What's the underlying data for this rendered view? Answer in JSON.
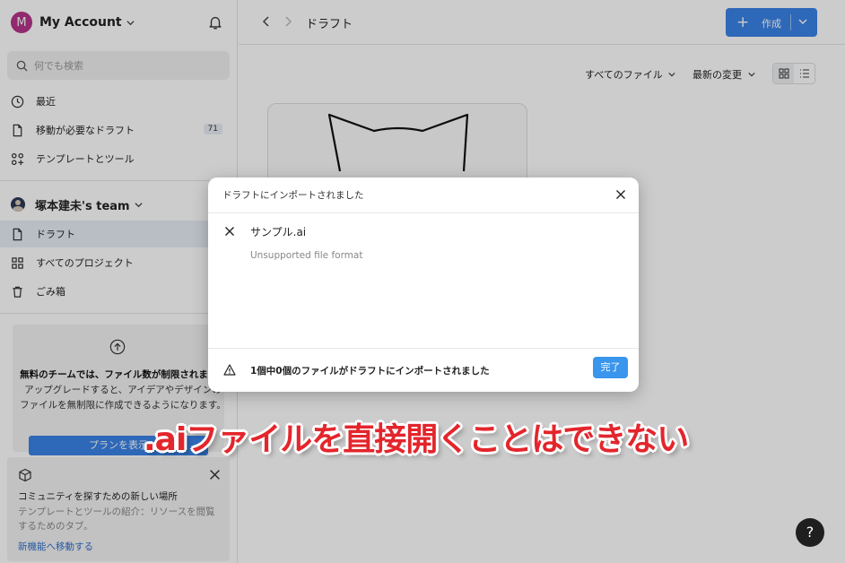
{
  "account": {
    "initial": "M",
    "name": "My Account",
    "avatar_color": "#b6358a"
  },
  "search": {
    "placeholder": "何でも検索"
  },
  "nav": {
    "recent": "最近",
    "drafts_to_move": "移動が必要なドラフト",
    "drafts_to_move_count": "71",
    "templates": "テンプレートとツール"
  },
  "team": {
    "name": "塚本建未's team",
    "drafts": "ドラフト",
    "all_projects": "すべてのプロジェクト",
    "trash": "ごみ箱"
  },
  "promo": {
    "bold": "無料のチームでは、ファイル数が制限されます。",
    "text": "アップグレードすると、アイデアやデザインのファイルを無制限に作成できるようになります。",
    "button": "プランを表示"
  },
  "community": {
    "title": "コミュニティを探すための新しい場所",
    "desc": "テンプレートとツールの紹介：リソースを閲覧するためのタブ。",
    "link": "新機能へ移動する"
  },
  "main": {
    "breadcrumb": "ドラフト",
    "create": "作成",
    "filter_files": "すべてのファイル",
    "sort": "最新の変更"
  },
  "modal": {
    "title": "ドラフトにインポートされました",
    "file_name": "サンプル.ai",
    "file_error": "Unsupported file format",
    "summary": "1個中0個のファイルがドラフトにインポートされました",
    "done": "完了"
  },
  "caption": ".aiファイルを直接開くことはできない",
  "help": "?",
  "colors": {
    "accent": "#3a82e6",
    "caption": "#e3262c"
  }
}
